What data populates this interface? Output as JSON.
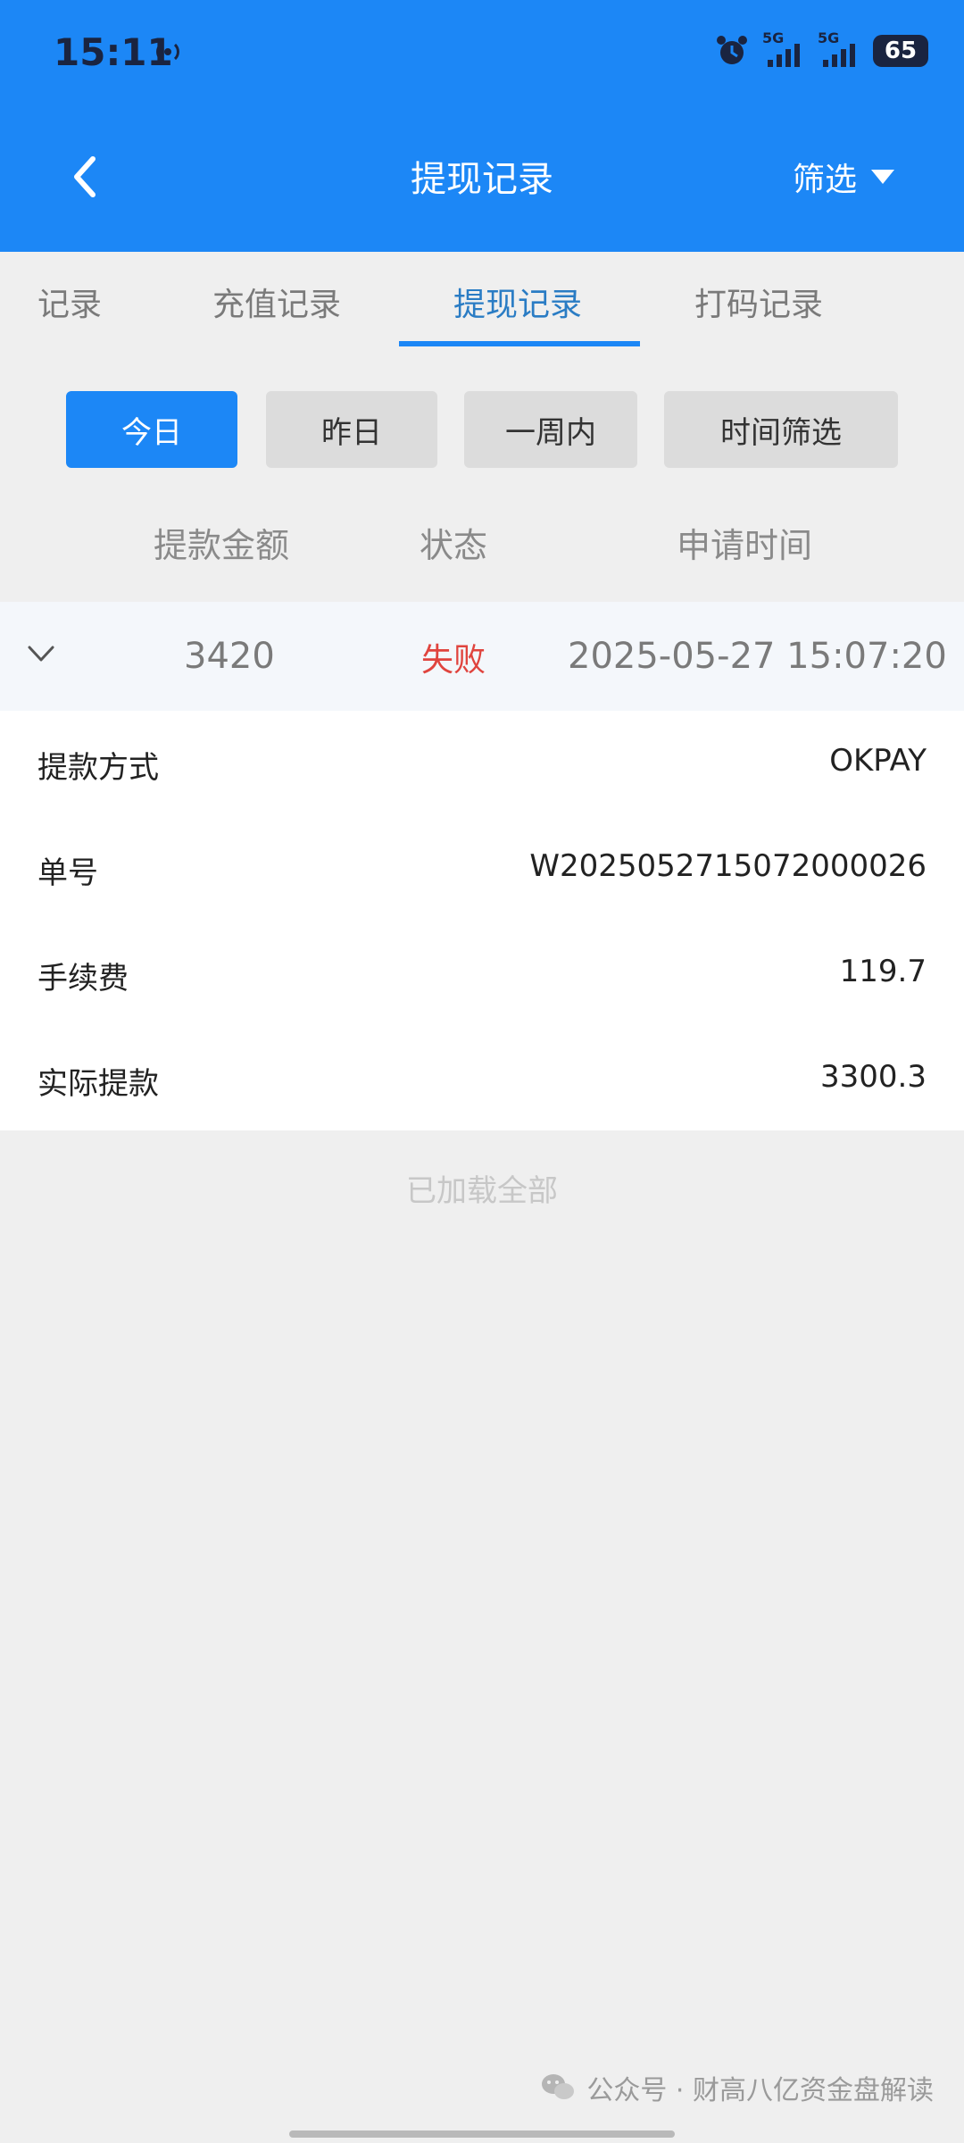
{
  "status_bar": {
    "time": "15:11",
    "signal_labels": [
      "5G",
      "5G"
    ],
    "battery": "65"
  },
  "header": {
    "title": "提现记录",
    "filter_label": "筛选"
  },
  "tabs": [
    {
      "label": "记录"
    },
    {
      "label": "充值记录"
    },
    {
      "label": "提现记录"
    },
    {
      "label": "打码记录"
    }
  ],
  "active_tab": "提现记录",
  "date_filters": [
    {
      "label": "今日"
    },
    {
      "label": "昨日"
    },
    {
      "label": "一周内"
    },
    {
      "label": "时间筛选"
    }
  ],
  "columns": {
    "amount": "提款金额",
    "status": "状态",
    "time": "申请时间"
  },
  "record": {
    "amount": "3420",
    "status": "失败",
    "time": "2025-05-27 15:07:20",
    "details": [
      {
        "label": "提款方式",
        "value": "OKPAY"
      },
      {
        "label": "单号",
        "value": "W2025052715072000026"
      },
      {
        "label": "手续费",
        "value": "119.7"
      },
      {
        "label": "实际提款",
        "value": "3300.3"
      }
    ]
  },
  "footer_text": "已加载全部",
  "watermark": "公众号 · 财高八亿资金盘解读",
  "colors": {
    "primary": "#1c87f6",
    "status_failed": "#e0443e",
    "active_tab_text": "#2a7cc4"
  }
}
